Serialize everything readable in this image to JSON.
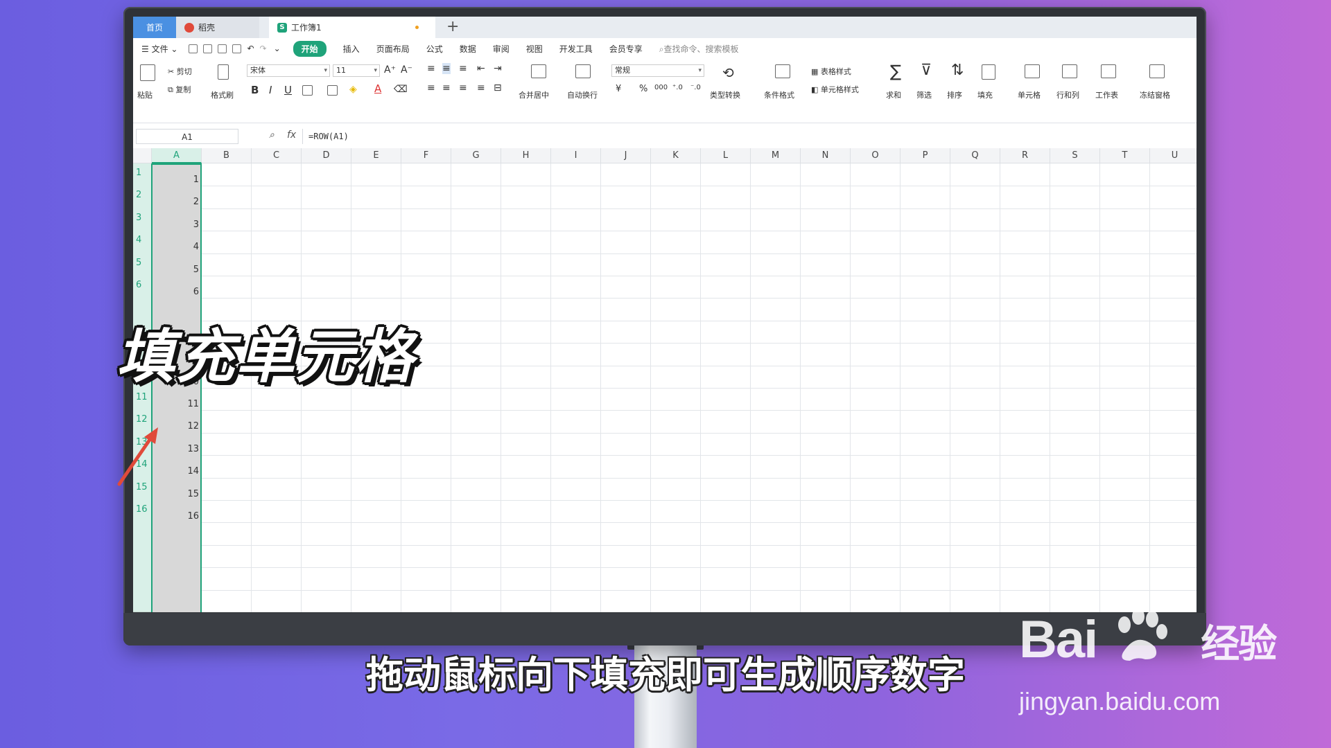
{
  "tabs": {
    "home": "首页",
    "daoke": "稻壳",
    "workbook": "工作簿1",
    "new_tab": "+"
  },
  "menu": {
    "file": "文件",
    "start": "开始",
    "items": [
      "插入",
      "页面布局",
      "公式",
      "数据",
      "审阅",
      "视图",
      "开发工具",
      "会员专享"
    ],
    "search_placeholder": "查找命令、搜索模板"
  },
  "ribbon": {
    "paste": "粘贴",
    "cut": "剪切",
    "copy": "复制",
    "format_painter": "格式刷",
    "font_name": "宋体",
    "font_size": "11",
    "bold": "B",
    "italic": "I",
    "underline": "U",
    "merge_center": "合并居中",
    "wrap_text": "自动换行",
    "number_format": "常规",
    "currency": "¥",
    "percent": "%",
    "thousands": "000",
    "type_convert": "类型转换",
    "conditional_format": "条件格式",
    "table_style": "表格样式",
    "cell_style": "单元格样式",
    "sum": "求和",
    "filter": "筛选",
    "sort": "排序",
    "fill": "填充",
    "cell": "单元格",
    "row_col": "行和列",
    "worksheet": "工作表",
    "freeze": "冻结窗格"
  },
  "formula_bar": {
    "name_box": "A1",
    "fx": "fx",
    "formula": "=ROW(A1)"
  },
  "sheet": {
    "columns": [
      "A",
      "B",
      "C",
      "D",
      "E",
      "F",
      "G",
      "H",
      "I",
      "J",
      "K",
      "L",
      "M",
      "N",
      "O",
      "P",
      "Q",
      "R",
      "S",
      "T",
      "U"
    ],
    "rows": [
      {
        "num": "1",
        "value": "1"
      },
      {
        "num": "2",
        "value": "2"
      },
      {
        "num": "3",
        "value": "3"
      },
      {
        "num": "4",
        "value": "4"
      },
      {
        "num": "5",
        "value": "5"
      },
      {
        "num": "6",
        "value": "6"
      },
      {
        "num": "9",
        "value": "9"
      },
      {
        "num": "10",
        "value": "10"
      },
      {
        "num": "11",
        "value": "11"
      },
      {
        "num": "12",
        "value": "12"
      },
      {
        "num": "13",
        "value": "13"
      },
      {
        "num": "14",
        "value": "14"
      },
      {
        "num": "15",
        "value": "15"
      },
      {
        "num": "16",
        "value": "16"
      }
    ]
  },
  "overlay": {
    "title": "填充单元格",
    "subtitle": "拖动鼠标向下填充即可生成顺序数字"
  },
  "watermark": {
    "brand": "Bai",
    "brand_cn": "经验",
    "url": "jingyan.baidu.com"
  },
  "colors": {
    "accent": "#1fa37a",
    "home_tab": "#4a90e2",
    "arrow": "#e04a3a"
  }
}
